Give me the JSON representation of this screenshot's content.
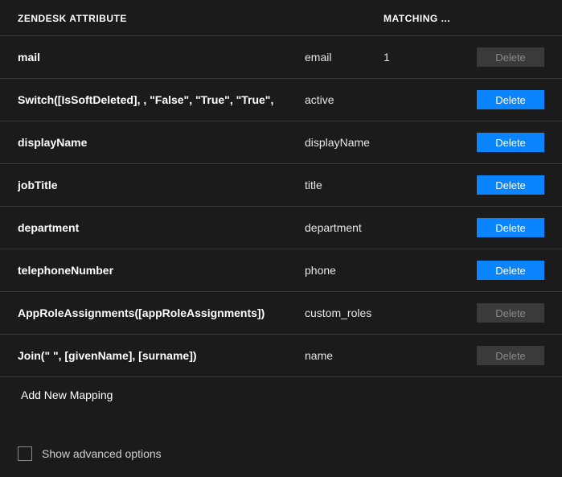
{
  "columns": {
    "zendesk": "ZENDESK ATTRIBUTE",
    "matching": "MATCHING ..."
  },
  "rows": [
    {
      "source": "mail",
      "target": "email",
      "matching": "1",
      "deleteStyle": "disabled",
      "deleteLabel": "Delete"
    },
    {
      "source": "Switch([IsSoftDeleted], , \"False\", \"True\", \"True\", ",
      "target": "active",
      "matching": "",
      "deleteStyle": "active",
      "deleteLabel": "Delete"
    },
    {
      "source": "displayName",
      "target": "displayName",
      "matching": "",
      "deleteStyle": "active",
      "deleteLabel": "Delete"
    },
    {
      "source": "jobTitle",
      "target": "title",
      "matching": "",
      "deleteStyle": "active",
      "deleteLabel": "Delete"
    },
    {
      "source": "department",
      "target": "department",
      "matching": "",
      "deleteStyle": "active",
      "deleteLabel": "Delete"
    },
    {
      "source": "telephoneNumber",
      "target": "phone",
      "matching": "",
      "deleteStyle": "active",
      "deleteLabel": "Delete"
    },
    {
      "source": "AppRoleAssignments([appRoleAssignments])",
      "target": "custom_roles",
      "matching": "",
      "deleteStyle": "disabled",
      "deleteLabel": "Delete"
    },
    {
      "source": "Join(\" \", [givenName], [surname])",
      "target": "name",
      "matching": "",
      "deleteStyle": "disabled",
      "deleteLabel": "Delete"
    }
  ],
  "addNewLabel": "Add New Mapping",
  "advancedLabel": "Show advanced options"
}
